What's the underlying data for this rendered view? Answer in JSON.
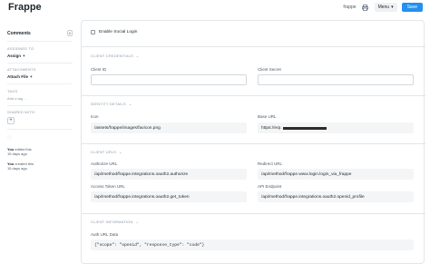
{
  "header": {
    "title": "Frappe",
    "user_link": "frappe",
    "menu_label": "Menu",
    "save_label": "Save"
  },
  "sidebar": {
    "comments_label": "Comments",
    "comments_count": "0",
    "assigned_to_label": "ASSIGNED TO",
    "assign_action": "Assign",
    "attachments_label": "ATTACHMENTS",
    "attach_action": "Attach File",
    "tags_label": "TAGS",
    "add_tag": "Add a tag ...",
    "shared_with_label": "SHARED WITH",
    "activity": [
      {
        "user": "You",
        "action": "edited this",
        "time": "15 days ago"
      },
      {
        "user": "You",
        "action": "created this",
        "time": "15 days ago"
      }
    ]
  },
  "form": {
    "enable_social_login_label": "Enable Social Login",
    "sections": {
      "client_credentials": "CLIENT CREDENTIALS",
      "identity_details": "IDENTITY DETAILS",
      "client_urls": "CLIENT URLS",
      "client_information": "CLIENT INFORMATION"
    },
    "fields": {
      "client_id": {
        "label": "Client ID",
        "value": ""
      },
      "client_secret": {
        "label": "Client Secret",
        "value": ""
      },
      "icon": {
        "label": "Icon",
        "value": "/assets/frappe/images/favicon.png"
      },
      "base_url": {
        "label": "Base URL",
        "value": "https://erp."
      },
      "authorize_url": {
        "label": "Authorize URL",
        "value": "/api/method/frappe.integrations.oauth2.authorize"
      },
      "redirect_url": {
        "label": "Redirect URL",
        "value": "/api/method/frappe.www.login.login_via_frappe"
      },
      "access_token_url": {
        "label": "Access Token URL",
        "value": "/api/method/frappe.integrations.oauth2.get_token"
      },
      "api_endpoint": {
        "label": "API Endpoint",
        "value": "/api/method/frappe.integrations.oauth2.openid_profile"
      },
      "auth_url_data": {
        "label": "Auth URL Data",
        "value": "{\"scope\": \"openid\", \"response_type\": \"code\"}"
      }
    }
  },
  "icons": {
    "print": "printer-icon",
    "caret": "caret-down-icon",
    "assign": "plus-icon",
    "attach": "plus-icon",
    "share": "plus-icon",
    "like": "heart-icon"
  },
  "colors": {
    "primary": "#2490ef",
    "text": "#1f272e",
    "muted": "#8d99a6",
    "control_bg": "#f4f5f6",
    "border": "#e2e6e9"
  }
}
